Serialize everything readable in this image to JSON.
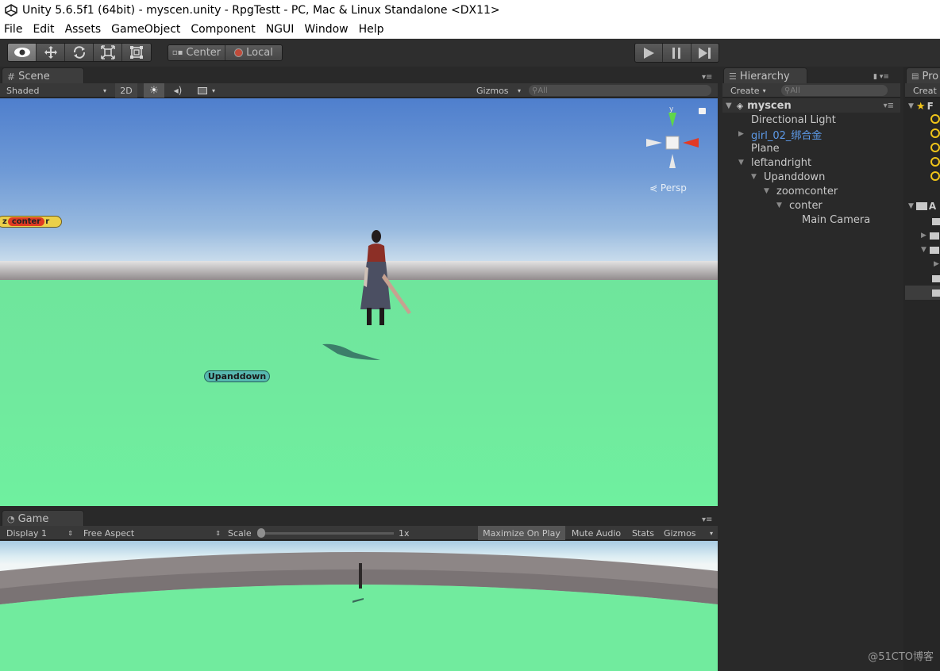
{
  "window": {
    "title": "Unity 5.6.5f1 (64bit) - myscen.unity - RpgTestt - PC, Mac & Linux Standalone <DX11>"
  },
  "menu": [
    "File",
    "Edit",
    "Assets",
    "GameObject",
    "Component",
    "NGUI",
    "Window",
    "Help"
  ],
  "toolbar": {
    "tools": [
      "view-tool",
      "move-tool",
      "rotate-tool",
      "scale-tool",
      "rect-tool"
    ],
    "pivot_center": "Center",
    "pivot_local": "Local",
    "play_controls": [
      "play",
      "pause",
      "step"
    ]
  },
  "scene": {
    "tab": "Scene",
    "shading": "Shaded",
    "mode_2d": "2D",
    "gizmos": "Gizmos",
    "search": "All",
    "gizmo_y": "y",
    "projection": "Persp",
    "labels": {
      "conter_prefix": "z",
      "conter": "conter",
      "conter_suffix": "r",
      "upanddown": "Upanddown"
    }
  },
  "game": {
    "tab": "Game",
    "display": "Display 1",
    "aspect": "Free Aspect",
    "scale_label": "Scale",
    "scale_value": "1x",
    "maximize": "Maximize On Play",
    "mute": "Mute Audio",
    "stats": "Stats",
    "gizmos": "Gizmos"
  },
  "hierarchy": {
    "tab": "Hierarchy",
    "create": "Create",
    "search": "All",
    "scene_name": "myscen",
    "items": [
      {
        "label": "Directional Light",
        "depth": 1,
        "arrow": "",
        "color": "#c8c8c8"
      },
      {
        "label": "girl_02_绑合金",
        "depth": 1,
        "arrow": "▶",
        "color": "#5d9ae8"
      },
      {
        "label": "Plane",
        "depth": 1,
        "arrow": "",
        "color": "#c8c8c8"
      },
      {
        "label": "leftandright",
        "depth": 1,
        "arrow": "▼",
        "color": "#c8c8c8"
      },
      {
        "label": "Upanddown",
        "depth": 2,
        "arrow": "▼",
        "color": "#c8c8c8"
      },
      {
        "label": "zoomconter",
        "depth": 3,
        "arrow": "▼",
        "color": "#c8c8c8"
      },
      {
        "label": "conter",
        "depth": 4,
        "arrow": "▼",
        "color": "#c8c8c8"
      },
      {
        "label": "Main Camera",
        "depth": 5,
        "arrow": "",
        "color": "#c8c8c8"
      }
    ]
  },
  "project": {
    "tab": "Pro",
    "create": "Creat",
    "favorites_initial": "F",
    "assets_initial": "A"
  },
  "watermark": "@51CTO博客"
}
